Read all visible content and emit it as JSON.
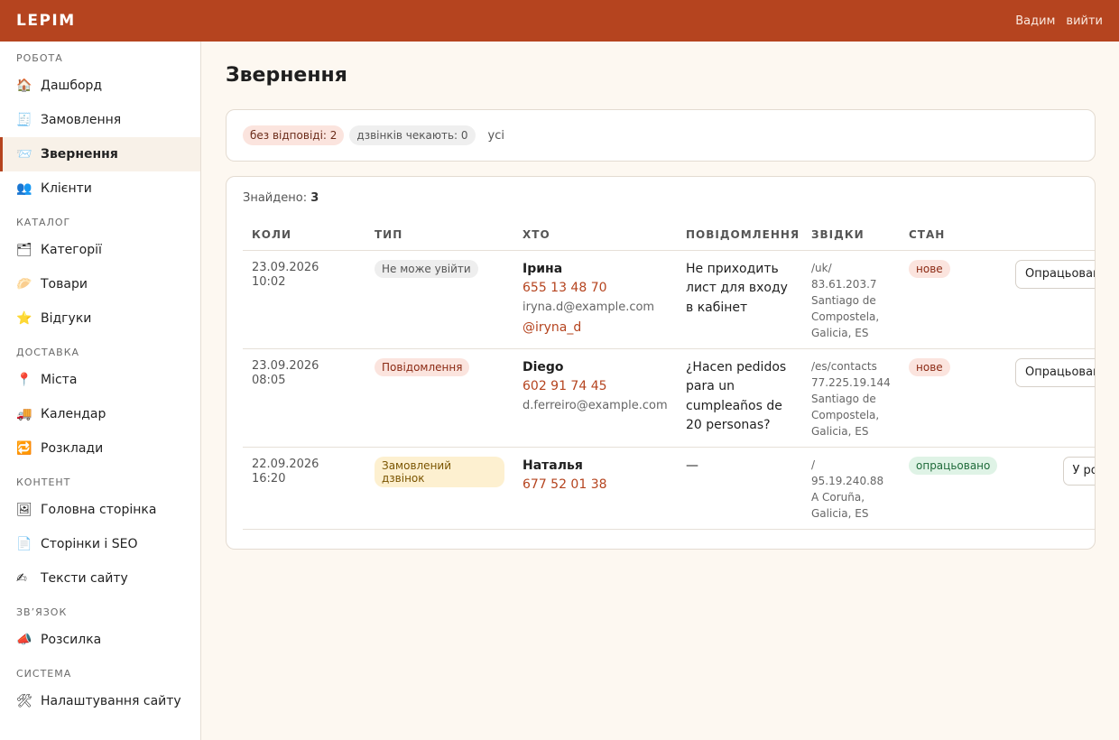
{
  "app": {
    "brand": "LEPIM",
    "user": "Вадим",
    "logout": "вийти"
  },
  "sidebar": {
    "sections": [
      {
        "title": "РОБОТА",
        "items": [
          {
            "icon": "🏠",
            "label": "Дашборд"
          },
          {
            "icon": "🧾",
            "label": "Замовлення"
          },
          {
            "icon": "📨",
            "label": "Звернення",
            "active": true
          },
          {
            "icon": "👥",
            "label": "Клієнти"
          }
        ]
      },
      {
        "title": "КАТАЛОГ",
        "items": [
          {
            "icon": "🗂",
            "label": "Категорії"
          },
          {
            "icon": "🥟",
            "label": "Товари"
          },
          {
            "icon": "⭐",
            "label": "Відгуки"
          }
        ]
      },
      {
        "title": "ДОСТАВКА",
        "items": [
          {
            "icon": "📍",
            "label": "Міста"
          },
          {
            "icon": "🚚",
            "label": "Календар"
          },
          {
            "icon": "🔁",
            "label": "Розклади"
          }
        ]
      },
      {
        "title": "КОНТЕНТ",
        "items": [
          {
            "icon": "🖼",
            "label": "Головна сторінка"
          },
          {
            "icon": "📄",
            "label": "Сторінки і SEO"
          },
          {
            "icon": "✍",
            "label": "Тексти сайту"
          }
        ]
      },
      {
        "title": "ЗВ’ЯЗОК",
        "items": [
          {
            "icon": "📣",
            "label": "Розсилка"
          }
        ]
      },
      {
        "title": "СИСТЕМА",
        "items": [
          {
            "icon": "🛠",
            "label": "Налаштування сайту"
          }
        ]
      }
    ]
  },
  "page": {
    "title": "Звернення"
  },
  "filters": {
    "unanswered": "без відповіді: 2",
    "calls_waiting": "дзвінків чекають: 0",
    "all": "усі"
  },
  "results": {
    "found_label": "Знайдено:",
    "found_count": "3",
    "columns": [
      "КОЛИ",
      "ТИП",
      "ХТО",
      "ПОВІДОМЛЕННЯ",
      "ЗВІДКИ",
      "СТАН"
    ],
    "rows": [
      {
        "when": "23.09.2026 10:02",
        "type": "Не може увійти",
        "type_style": "gray",
        "name": "Ірина",
        "phone": "655 13 48 70",
        "email": "iryna.d@example.com",
        "handle": "@iryna_d",
        "message": "Не приходить лист для входу в кабінет",
        "from": [
          "/uk/",
          "83.61.203.7",
          "Santiago de",
          "Compostela,",
          "Galicia, ES"
        ],
        "status": "нове",
        "status_style": "red",
        "action": "Опрацьовано"
      },
      {
        "when": "23.09.2026 08:05",
        "type": "Повідомлення",
        "type_style": "red",
        "name": "Diego",
        "phone": "602 91 74 45",
        "email": "d.ferreiro@example.com",
        "handle": "",
        "message": "¿Hacen pedidos para un cumpleaños de 20 personas?",
        "from": [
          "/es/contacts",
          "77.225.19.144",
          "Santiago de",
          "Compostela,",
          "Galicia, ES"
        ],
        "status": "нове",
        "status_style": "red",
        "action": "Опрацьовано"
      },
      {
        "when": "22.09.2026 16:20",
        "type": "Замовлений дзвінок",
        "type_style": "yellow",
        "name": "Наталья",
        "phone": "677 52 01 38",
        "email": "",
        "handle": "",
        "message": "—",
        "from": [
          "/",
          "95.19.240.88",
          "A Coruña,",
          "Galicia, ES"
        ],
        "status": "опрацьовано",
        "status_style": "green",
        "action": "У роботу"
      }
    ]
  }
}
